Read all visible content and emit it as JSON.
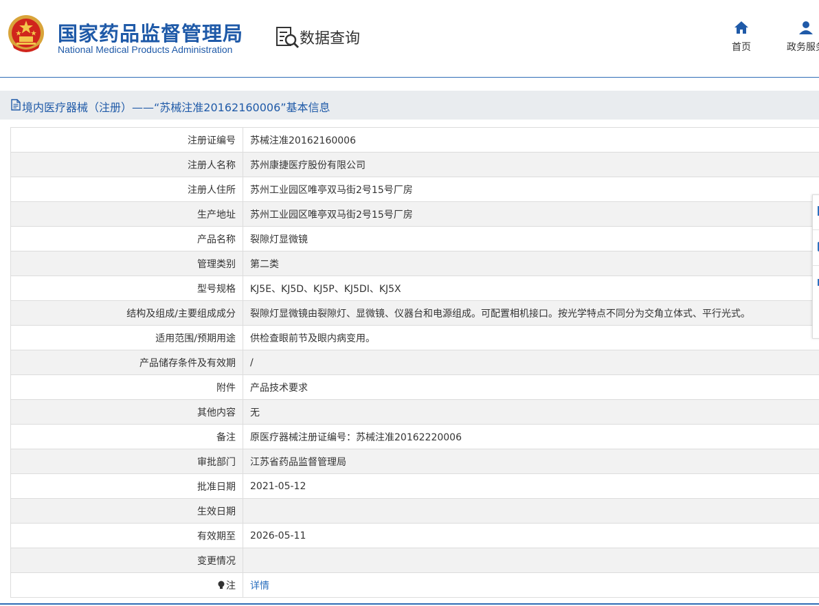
{
  "header": {
    "org_name_cn": "国家药品监督管理局",
    "org_name_en": "National Medical Products Administration",
    "section_title": "数据查询",
    "nav": [
      {
        "label": "首页",
        "icon": "home-icon"
      },
      {
        "label": "政务服务",
        "icon": "user-icon"
      }
    ]
  },
  "page": {
    "title": "境内医疗器械（注册）——“苏械注准20162160006”基本信息"
  },
  "colors": {
    "brand_blue": "#1f5aa8",
    "link_blue": "#2a6fbf",
    "title_bar_bg": "#e9ecef",
    "row_alt_bg": "#f2f2f2"
  },
  "table": {
    "rows": [
      {
        "label": "注册证编号",
        "value": "苏械注准20162160006"
      },
      {
        "label": "注册人名称",
        "value": "苏州康捷医疗股份有限公司"
      },
      {
        "label": "注册人住所",
        "value": "苏州工业园区唯亭双马街2号15号厂房"
      },
      {
        "label": "生产地址",
        "value": "苏州工业园区唯亭双马街2号15号厂房"
      },
      {
        "label": "产品名称",
        "value": "裂隙灯显微镜"
      },
      {
        "label": "管理类别",
        "value": "第二类"
      },
      {
        "label": "型号规格",
        "value": "KJ5E、KJ5D、KJ5P、KJ5DI、KJ5X"
      },
      {
        "label": "结构及组成/主要组成成分",
        "value": "裂隙灯显微镜由裂隙灯、显微镜、仪器台和电源组成。可配置相机接口。按光学特点不同分为交角立体式、平行光式。"
      },
      {
        "label": "适用范围/预期用途",
        "value": "供检查眼前节及眼内病变用。"
      },
      {
        "label": "产品储存条件及有效期",
        "value": "/"
      },
      {
        "label": "附件",
        "value": "产品技术要求"
      },
      {
        "label": "其他内容",
        "value": "无"
      },
      {
        "label": "备注",
        "value": "原医疗器械注册证编号：苏械注准20162220006"
      },
      {
        "label": "审批部门",
        "value": "江苏省药品监督管理局"
      },
      {
        "label": "批准日期",
        "value": "2021-05-12"
      },
      {
        "label": "生效日期",
        "value": ""
      },
      {
        "label": "有效期至",
        "value": "2026-05-11"
      },
      {
        "label": "变更情况",
        "value": ""
      }
    ],
    "note_row": {
      "label": "注",
      "link_text": "详情",
      "icon": "lightbulb-icon"
    }
  }
}
